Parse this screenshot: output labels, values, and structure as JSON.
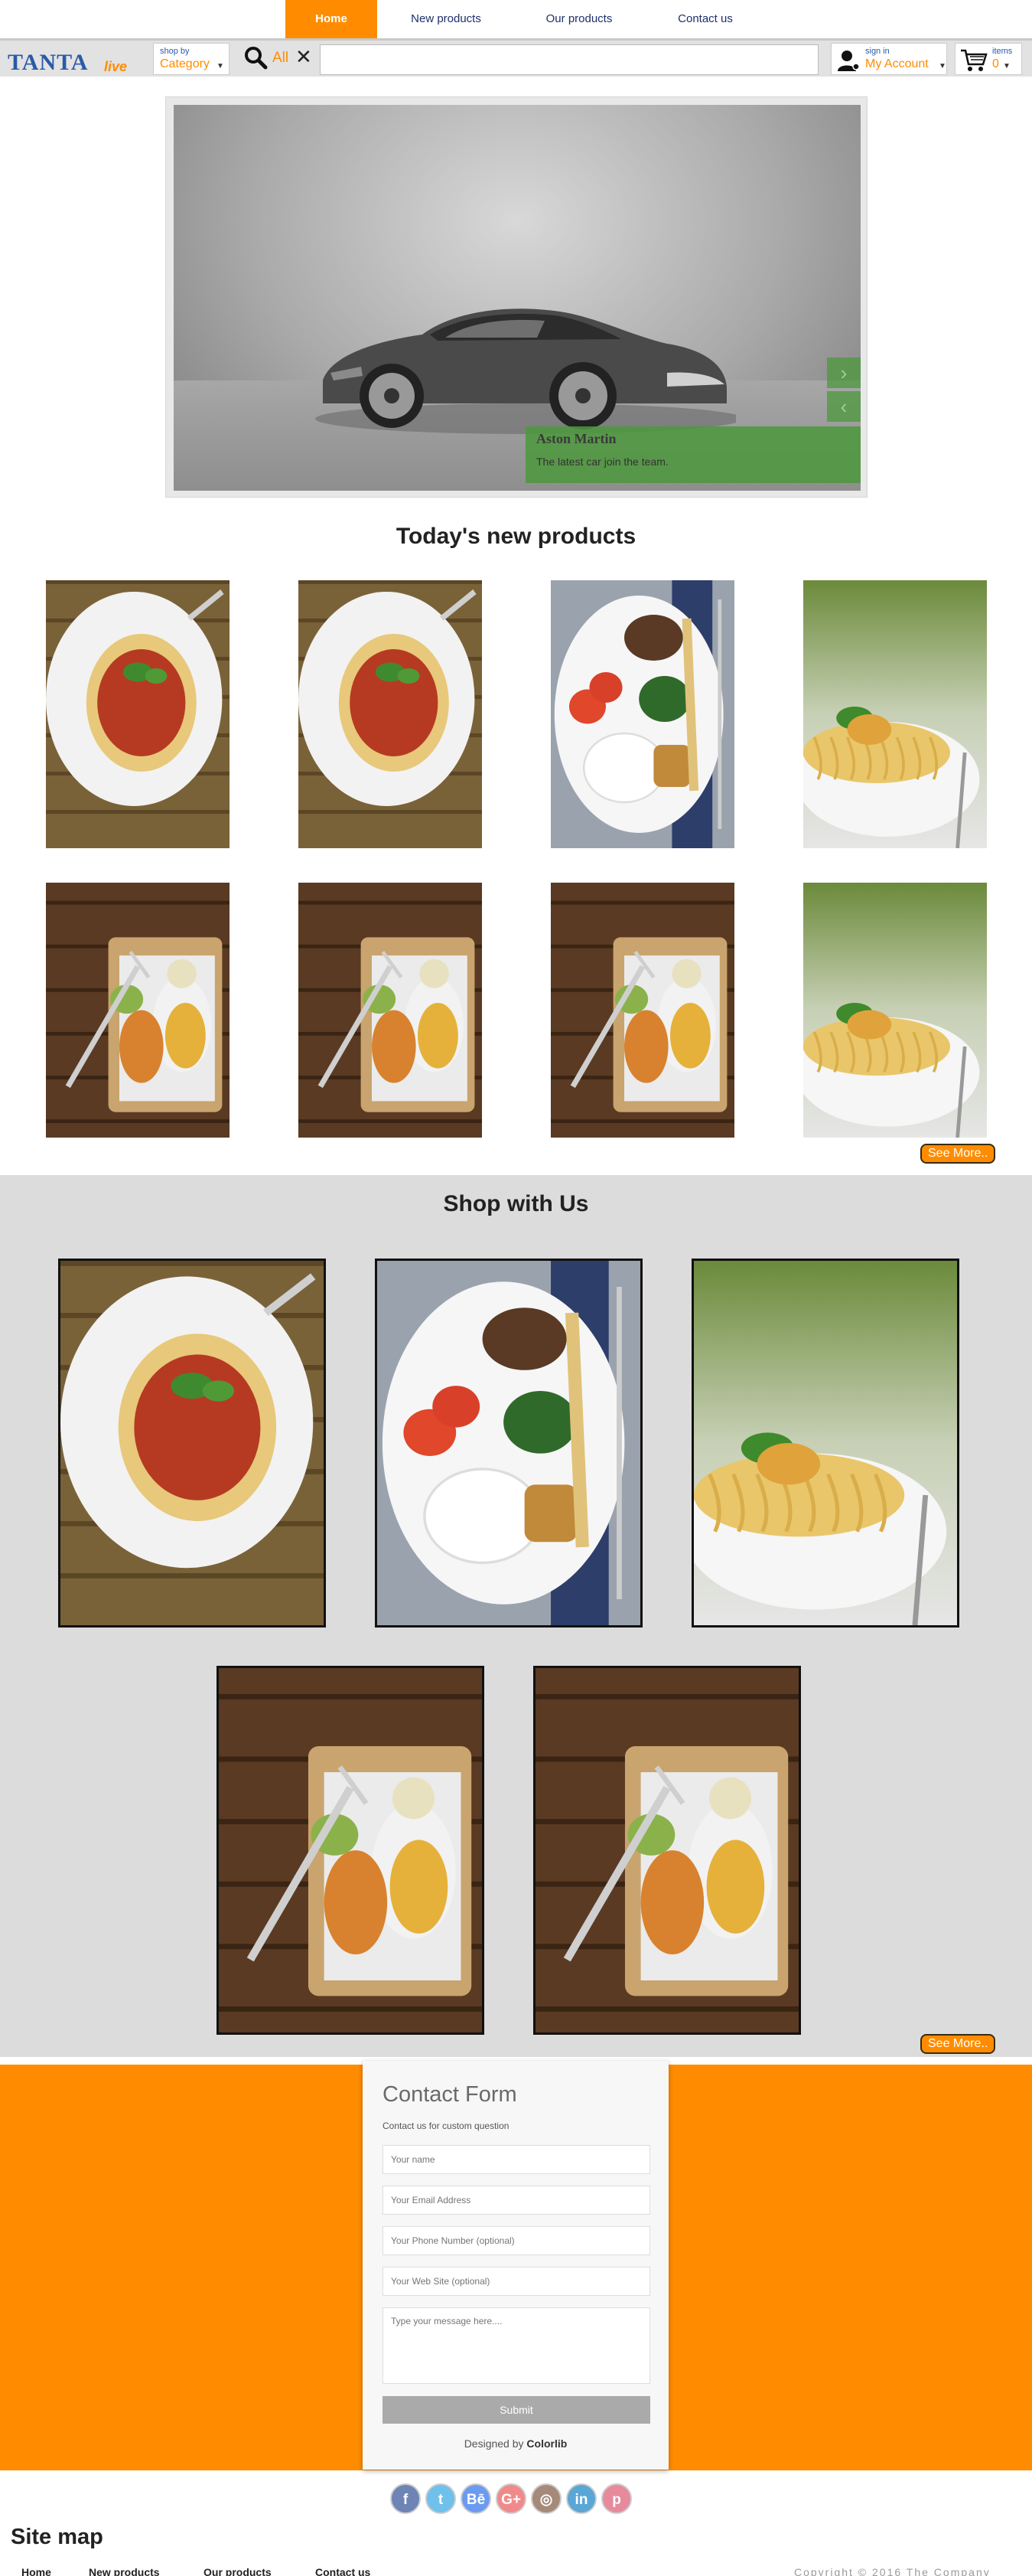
{
  "nav": {
    "items": [
      {
        "label": "Home",
        "active": true
      },
      {
        "label": "New products",
        "active": false
      },
      {
        "label": "Our products",
        "active": false
      },
      {
        "label": "Contact us",
        "active": false
      }
    ]
  },
  "header": {
    "logo": {
      "primary": "TANTA",
      "secondary": "live"
    },
    "category": {
      "small": "shop by",
      "value": "Category"
    },
    "search": {
      "scope": "All",
      "clear_icon": "close-icon",
      "value": ""
    },
    "account": {
      "small": "sign in",
      "value": "My Account"
    },
    "cart": {
      "small": "items",
      "count": "0"
    }
  },
  "carousel": {
    "caption_title": "Aston Martin",
    "caption_text": "The latest car join the team.",
    "next_glyph": "›",
    "prev_glyph": "‹"
  },
  "new_products": {
    "title": "Today's new products",
    "items": [
      "spaghetti",
      "spaghetti",
      "breakfast",
      "pasta-bowl",
      "schnitzel",
      "schnitzel",
      "schnitzel",
      "pasta-bowl"
    ],
    "see_more": "See More.."
  },
  "shop": {
    "title": "Shop with Us",
    "items": [
      "spaghetti",
      "breakfast",
      "pasta-bowl",
      "schnitzel",
      "schnitzel"
    ],
    "see_more": "See More.."
  },
  "contact": {
    "title": "Contact Form",
    "subtitle": "Contact us for custom question",
    "name_placeholder": "Your name",
    "email_placeholder": "Your Email Address",
    "phone_placeholder": "Your Phone Number (optional)",
    "web_placeholder": "Your Web Site (optional)",
    "message_placeholder": "Type your message here....",
    "submit": "Submit",
    "credit_prefix": "Designed by ",
    "credit_name": "Colorlib"
  },
  "socials": [
    {
      "name": "facebook",
      "glyph": "f",
      "color": "#6d84b4"
    },
    {
      "name": "twitter",
      "glyph": "t",
      "color": "#6fc1ec"
    },
    {
      "name": "behance",
      "glyph": "Bē",
      "color": "#6b9bf0"
    },
    {
      "name": "google-plus",
      "glyph": "G+",
      "color": "#f08a8a"
    },
    {
      "name": "instagram",
      "glyph": "◎",
      "color": "#a58a7a"
    },
    {
      "name": "linkedin",
      "glyph": "in",
      "color": "#5aa6d6"
    },
    {
      "name": "pinterest",
      "glyph": "p",
      "color": "#e78a9c"
    }
  ],
  "footer": {
    "sitemap_title": "Site map",
    "links": [
      "Home",
      "New products",
      "Our products",
      "Contact us"
    ],
    "copyright": "Copyright © 2016 The Company"
  },
  "colors": {
    "accent": "#ff8c00",
    "nav_text": "#1e2f6b",
    "caption_green": "#4c983c"
  }
}
